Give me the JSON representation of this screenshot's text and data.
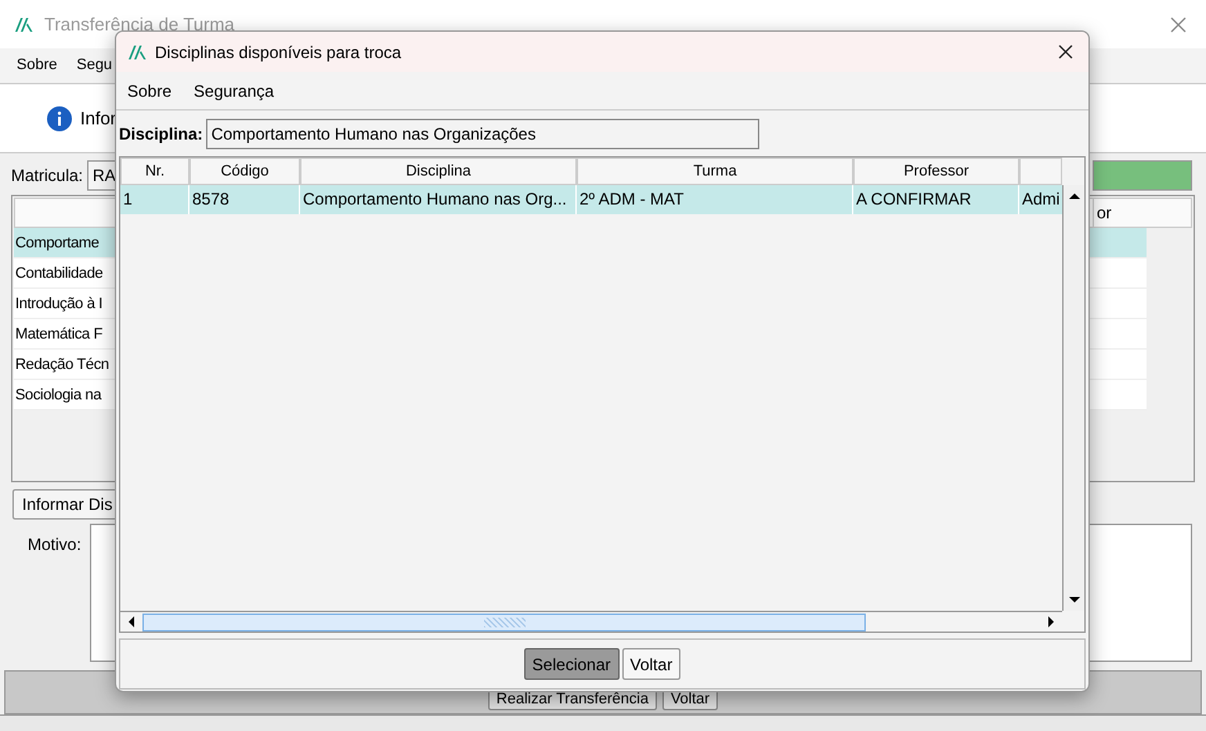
{
  "main_window": {
    "title": "Transferência de Turma",
    "menu": [
      "Sobre",
      "Segu"
    ],
    "info_text": "Infor",
    "matricula_label": "Matricula:",
    "matricula_value": "RA",
    "progress": {
      "level": 1
    },
    "list_rows": [
      {
        "text": "Comportame",
        "selected": true
      },
      {
        "text": "Contabilidade",
        "selected": false
      },
      {
        "text": "Introdução à I",
        "selected": false
      },
      {
        "text": "Matemática F",
        "selected": false
      },
      {
        "text": "Redação Técn",
        "selected": false
      },
      {
        "text": "Sociologia na",
        "selected": false
      }
    ],
    "column_header": "or",
    "inform_button": "Informar Dis",
    "motivo_label": "Motivo:",
    "buttons": [
      "Realizar Transferência",
      "Voltar"
    ]
  },
  "dialog": {
    "title": "Disciplinas disponíveis para troca",
    "menu": [
      "Sobre",
      "Segurança"
    ],
    "disciplina_label": "Disciplina:",
    "disciplina_value": "Comportamento Humano nas Organizações",
    "table": {
      "columns": [
        "Nr.",
        "Código",
        "Disciplina",
        "Turma",
        "Professor"
      ],
      "rows": [
        {
          "cells": [
            "1",
            "8578",
            "Comportamento Humano nas Org...",
            "2º ADM - MAT",
            "A CONFIRMAR",
            "Admi"
          ],
          "selected": true
        }
      ]
    },
    "buttons": [
      {
        "label": "Selecionar",
        "selected": true
      },
      {
        "label": "Voltar",
        "selected": false
      }
    ]
  }
}
